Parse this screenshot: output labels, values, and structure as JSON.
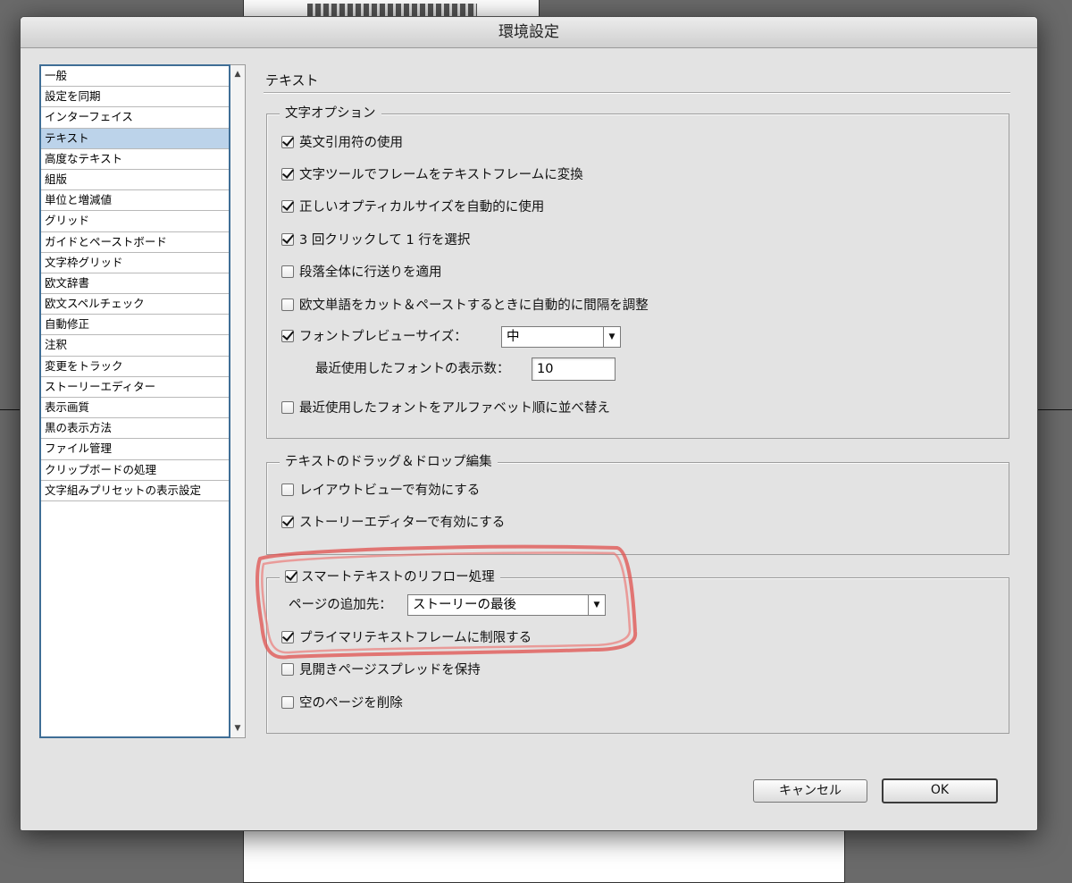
{
  "dialog": {
    "title": "環境設定"
  },
  "sidebar": {
    "items": [
      {
        "label": "一般"
      },
      {
        "label": "設定を同期"
      },
      {
        "label": "インターフェイス"
      },
      {
        "label": "テキスト",
        "selected": true
      },
      {
        "label": "高度なテキスト"
      },
      {
        "label": "組版"
      },
      {
        "label": "単位と増減値"
      },
      {
        "label": "グリッド"
      },
      {
        "label": "ガイドとペーストボード"
      },
      {
        "label": "文字枠グリッド"
      },
      {
        "label": "欧文辞書"
      },
      {
        "label": "欧文スペルチェック"
      },
      {
        "label": "自動修正"
      },
      {
        "label": "注釈"
      },
      {
        "label": "変更をトラック"
      },
      {
        "label": "ストーリーエディター"
      },
      {
        "label": "表示画質"
      },
      {
        "label": "黒の表示方法"
      },
      {
        "label": "ファイル管理"
      },
      {
        "label": "クリップボードの処理"
      },
      {
        "label": "文字組みプリセットの表示設定"
      }
    ]
  },
  "main": {
    "section_title": "テキスト",
    "text_options": {
      "legend": "文字オプション",
      "use_typographer_quotes": {
        "label": "英文引用符の使用",
        "checked": true
      },
      "type_tool_converts_frames": {
        "label": "文字ツールでフレームをテキストフレームに変換",
        "checked": true
      },
      "auto_optical_size": {
        "label": "正しいオプティカルサイズを自動的に使用",
        "checked": true
      },
      "triple_click_line": {
        "label": "3 回クリックして 1 行を選択",
        "checked": true
      },
      "apply_leading_paragraph": {
        "label": "段落全体に行送りを適用",
        "checked": false
      },
      "adjust_spacing": {
        "label": "欧文単語をカット＆ペーストするときに自動的に間隔を調整",
        "checked": false
      },
      "font_preview_size": {
        "label": "フォントプレビューサイズ：",
        "checked": true,
        "value": "中"
      },
      "recent_fonts_count": {
        "label": "最近使用したフォントの表示数：",
        "value": "10"
      },
      "sort_recent_fonts": {
        "label": "最近使用したフォントをアルファベット順に並べ替え",
        "checked": false
      }
    },
    "drag_drop": {
      "legend": "テキストのドラッグ＆ドロップ編集",
      "enable_layout_view": {
        "label": "レイアウトビューで有効にする",
        "checked": false
      },
      "enable_story_editor": {
        "label": "ストーリーエディターで有効にする",
        "checked": true
      }
    },
    "smart_reflow": {
      "legend": "スマートテキストのリフロー処理",
      "checked": true,
      "add_pages_to": {
        "label": "ページの追加先：",
        "value": "ストーリーの最後"
      },
      "limit_primary_frames": {
        "label": "プライマリテキストフレームに制限する",
        "checked": true
      },
      "preserve_spreads": {
        "label": "見開きページスプレッドを保持",
        "checked": false
      },
      "delete_empty_pages": {
        "label": "空のページを削除",
        "checked": false
      }
    }
  },
  "buttons": {
    "cancel": "キャンセル",
    "ok": "OK"
  },
  "colors": {
    "selection": "#bcd3ea",
    "list_border": "#3f6e96",
    "annotation": "#e0504e"
  }
}
